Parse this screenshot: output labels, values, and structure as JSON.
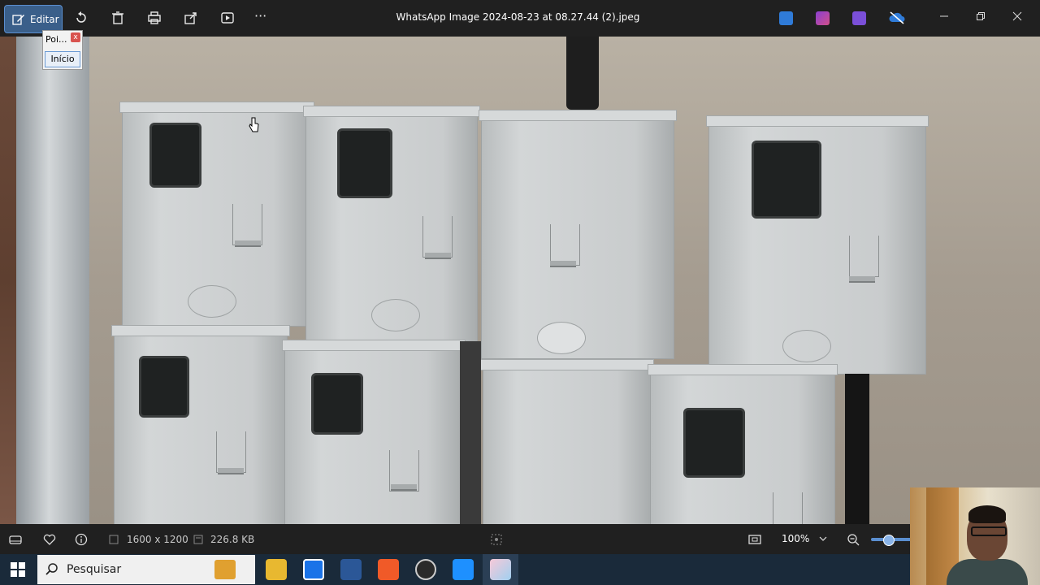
{
  "toolbar": {
    "edit_label": "Editar",
    "title": "WhatsApp Image 2024-08-23 at 08.27.44 (2).jpeg",
    "icons": [
      "edit-icon",
      "rotate-icon",
      "delete-icon",
      "print-icon",
      "share-icon",
      "slideshow-icon",
      "more-icon"
    ],
    "more_label": "···"
  },
  "popup": {
    "title": "Poi...",
    "close": "x",
    "button": "Início"
  },
  "status": {
    "dimensions": "1600 x 1200",
    "size": "226.8 KB",
    "zoom": "100%",
    "zoom_level_percent": 100
  },
  "taskbar": {
    "search_placeholder": "Pesquisar"
  },
  "colors": {
    "accent": "#5b8fd0",
    "toolbar_bg": "#202020",
    "taskbar_bg": "#1a2a3a"
  }
}
